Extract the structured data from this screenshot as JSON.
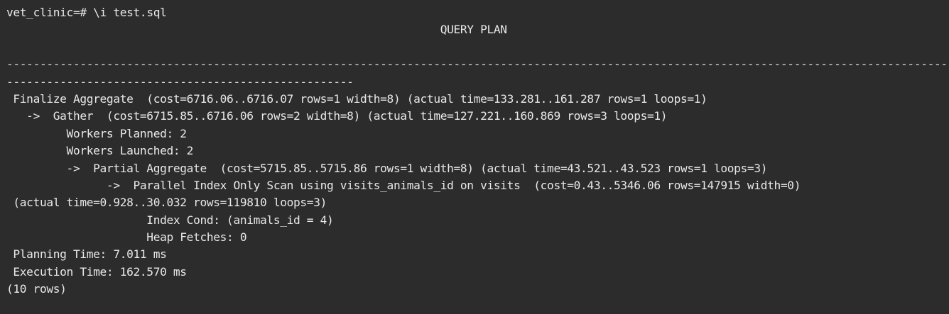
{
  "terminal": {
    "prompt": "vet_clinic=# ",
    "command": "\\i test.sql",
    "header": "                                                                 QUERY PLAN",
    "blank": "",
    "separator_1": "-------------------------------------------------------------------------------------------------------------------------------------------------",
    "separator_2": "----------------------------------------------------",
    "lines": [
      " Finalize Aggregate  (cost=6716.06..6716.07 rows=1 width=8) (actual time=133.281..161.287 rows=1 loops=1)",
      "   ->  Gather  (cost=6715.85..6716.06 rows=2 width=8) (actual time=127.221..160.869 rows=3 loops=1)",
      "         Workers Planned: 2",
      "         Workers Launched: 2",
      "         ->  Partial Aggregate  (cost=5715.85..5715.86 rows=1 width=8) (actual time=43.521..43.523 rows=1 loops=3)",
      "               ->  Parallel Index Only Scan using visits_animals_id on visits  (cost=0.43..5346.06 rows=147915 width=0)",
      " (actual time=0.928..30.032 rows=119810 loops=3)",
      "                     Index Cond: (animals_id = 4)",
      "                     Heap Fetches: 0",
      " Planning Time: 7.011 ms",
      " Execution Time: 162.570 ms"
    ],
    "footer": "(10 rows)"
  }
}
